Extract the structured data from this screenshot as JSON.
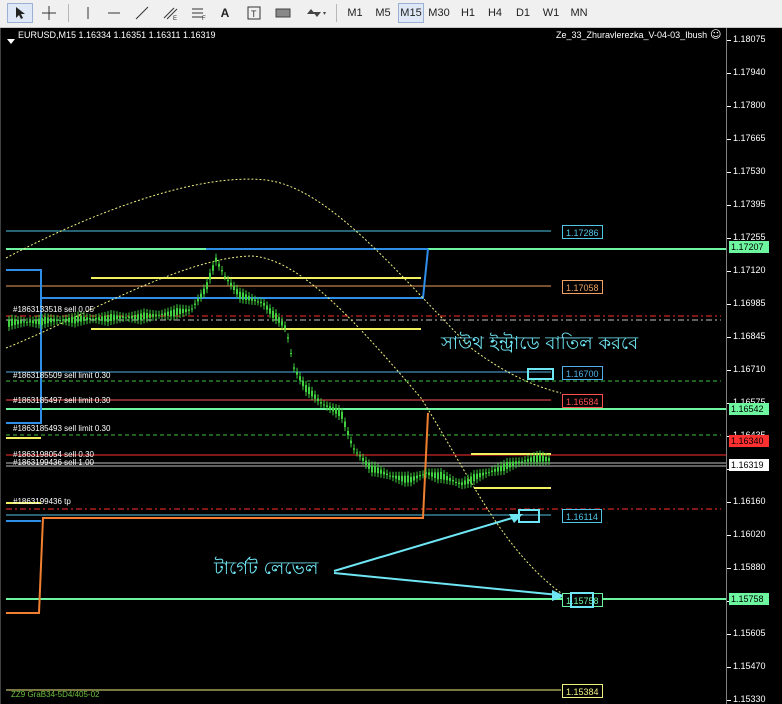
{
  "toolbar": {
    "timeframes": [
      "M1",
      "M5",
      "M15",
      "M30",
      "H1",
      "H4",
      "D1",
      "W1",
      "MN"
    ],
    "active_timeframe": "M15",
    "tools": [
      "cursor-icon",
      "crosshair-icon",
      "vertical-line-icon",
      "horizontal-line-icon",
      "trend-line-icon",
      "equidistant-channel-icon",
      "fibonacci-icon",
      "text-icon",
      "text-label-icon",
      "rectangle-icon",
      "arrows-icon"
    ]
  },
  "chart": {
    "header": "EURUSD,M15  1.16334 1.16351 1.16311 1.16319",
    "indicator": "Ze_33_Zhuravlerezka_V-04-03_Ibush",
    "smiley": "☺",
    "footer": "ZZ9 GraB34-5D4/405-02"
  },
  "price_scale": {
    "ticks": [
      "1.18075",
      "1.17940",
      "1.17800",
      "1.17665",
      "1.17530",
      "1.17395",
      "1.17255",
      "1.17120",
      "1.16985",
      "1.16845",
      "1.16710",
      "1.16575",
      "1.16435",
      "1.16295",
      "1.16160",
      "1.16020",
      "1.15880",
      "1.15745",
      "1.15605",
      "1.15470",
      "1.15330"
    ],
    "boxes": [
      {
        "value": "1.17207",
        "color": "#6ef5a0"
      },
      {
        "value": "1.16542",
        "color": "#6ef5a0"
      },
      {
        "value": "1.16340",
        "color": "#ff3030"
      },
      {
        "value": "1.16319",
        "color": "#ffffff"
      },
      {
        "value": "1.15758",
        "color": "#6ef5a0"
      }
    ]
  },
  "levels": [
    {
      "value": "1.17286",
      "color": "#4fc6e8"
    },
    {
      "value": "1.17058",
      "color": "#f0a060"
    },
    {
      "value": "1.16700",
      "color": "#4fb0e8"
    },
    {
      "value": "1.16584",
      "color": "#ff5050"
    },
    {
      "value": "1.16114",
      "color": "#4fc6e8"
    },
    {
      "value": "1.15758",
      "color": "#6ef5a0"
    },
    {
      "value": "1.15384",
      "color": "#f0f080"
    }
  ],
  "orders": [
    {
      "text": "#1863133518 sell 0.05"
    },
    {
      "text": "#1863185509 sell limit 0.30"
    },
    {
      "text": "#1863185497 sell limit 0.30"
    },
    {
      "text": "#1863185493 sell limit 0.30"
    },
    {
      "text": "#1863198054 sell 0.30"
    },
    {
      "text": "#1863199436 sell 1.00"
    },
    {
      "text": "#1863199436 tp"
    }
  ],
  "annotations": {
    "cancel_entry": "সাউথ ইন্ট্রাডে বাতিল করবে",
    "target_level": "টার্গেট লেভেল"
  }
}
